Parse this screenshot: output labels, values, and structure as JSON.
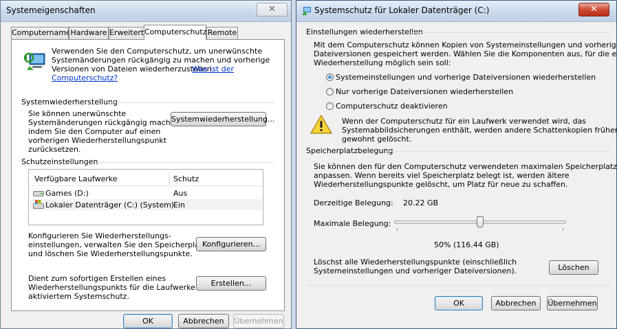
{
  "left_window": {
    "title": "Systemeigenschaften",
    "close_label": "✕",
    "tabs": [
      {
        "label": "Computername"
      },
      {
        "label": "Hardware"
      },
      {
        "label": "Erweitert"
      },
      {
        "label": "Computerschutz",
        "active": true
      },
      {
        "label": "Remote"
      }
    ],
    "intro": {
      "line1": "Verwenden Sie den Computerschutz, um unerwünschte",
      "line2": "Systemänderungen rückgängig zu machen und vorherige",
      "line3": "Versionen von Dateien wiederherzustellen.",
      "link1": "Was ist der",
      "link2": "Computerschutz?"
    },
    "restore_group": {
      "heading": "Systemwiederherstellung",
      "line1": "Sie können unerwünschte",
      "line2": "Systemänderungen rückgängig machen,",
      "line3": "indem Sie den Computer auf einen",
      "line4": "vorherigen Wiederherstellungspunkt",
      "line5": "zurücksetzen.",
      "button": "Systemwiederherstellung..."
    },
    "protection_group": {
      "heading": "Schutzeinstellungen",
      "columns": [
        "Verfügbare Laufwerke",
        "Schutz"
      ],
      "rows": [
        {
          "drive": "Games (D:)",
          "status": "Aus"
        },
        {
          "drive": "Lokaler Datenträger (C:) (System)",
          "status": "Ein"
        }
      ],
      "configure_line1": "Konfigurieren Sie Wiederherstellungs-",
      "configure_line2": "einstellungen, verwalten Sie den Speicherplatz,",
      "configure_line3": "und löschen Sie Wiederherstellungspunkte.",
      "configure_button": "Konfigurieren...",
      "create_line1": "Dient zum sofortigen Erstellen eines",
      "create_line2": "Wiederherstellungspunkts für die Laufwerke mit",
      "create_line3": "aktiviertem Systemschutz.",
      "create_button": "Erstellen..."
    },
    "buttons": {
      "ok": "OK",
      "cancel": "Abbrechen",
      "apply": "Übernehmen"
    }
  },
  "right_window": {
    "title": "Systemschutz für Lokaler Datenträger (C:)",
    "close_label": "✕",
    "restore_settings": {
      "heading": "Einstellungen wiederherstellen",
      "line1": "Mit dem Computerschutz können Kopien von Systemeinstellungen und vorherigen",
      "line2": "Dateiversionen gespeichert werden. Wählen Sie die Komponenten aus, für die eine",
      "line3": "Wiederherstellung möglich sein soll:",
      "options": [
        {
          "label": "Systemeinstellungen und vorherige Dateiversionen wiederherstellen",
          "selected": true
        },
        {
          "label": "Nur vorherige Dateiversionen wiederherstellen",
          "selected": false
        },
        {
          "label": "Computerschutz deaktivieren",
          "selected": false
        }
      ],
      "warning_line1": "Wenn der Computerschutz für ein Laufwerk verwendet wird, das",
      "warning_line2": "Systemabbildsicherungen enthält, werden andere Schattenkopien früher als",
      "warning_line3": "gewohnt gelöscht."
    },
    "disk_usage": {
      "heading": "Speicherplatzbelegung",
      "line1": "Sie können den für den Computerschutz verwendeten maximalen Speicherplatz",
      "line2": "anpassen. Wenn bereits viel Speicherplatz belegt ist, werden ältere",
      "line3": "Wiederherstellungspunkte gelöscht, um Platz für neue zu schaffen.",
      "current_label": "Derzeitige Belegung:",
      "current_value": "20.22 GB",
      "max_label": "Maximale Belegung:",
      "max_fraction": 0.5,
      "max_value": "50% (116.44 GB)",
      "delete_line1": "Löschst alle Wiederherstellungspunkte (einschließlich",
      "delete_line2": "Systemeinstellungen und vorheriger Dateiversionen).",
      "delete_button": "Löschen"
    },
    "buttons": {
      "ok": "OK",
      "cancel": "Abbrechen",
      "apply": "Übernehmen"
    }
  }
}
